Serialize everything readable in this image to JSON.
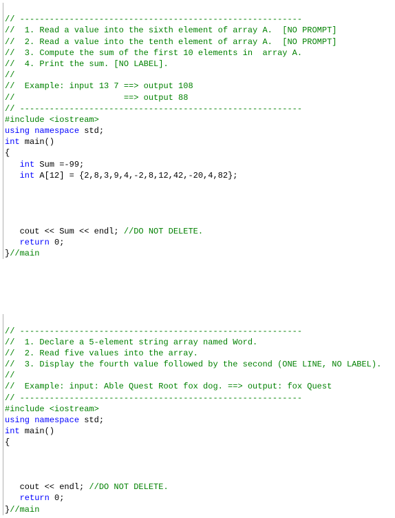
{
  "block1": {
    "c01": "// ---------------------------------------------------------",
    "c02": "//  1. Read a value into the sixth element of array A.  [NO PROMPT]",
    "c03": "//  2. Read a value into the tenth element of array A.  [NO PROMPT]",
    "c04": "//  3. Compute the sum of the first 10 elements in  array A.",
    "c05": "//  4. Print the sum. [NO LABEL].",
    "c06": "//",
    "c07": "//  Example: input 13 7 ==> output 108",
    "c08": "//                      ==> output 88",
    "c09": "// ---------------------------------------------------------",
    "inc": "#include <iostream>",
    "ns_using": "using",
    "ns_namespace": " namespace",
    "ns_std": " std;",
    "kw_int": "int",
    "main_decl": " main()",
    "brace_open": "{",
    "line_sum_int": "   int",
    "line_sum_rest": " Sum =-99;",
    "line_arr_int": "   int",
    "line_arr_rest": " A[12] = {2,8,3,9,4,-2,8,12,42,-20,4,82};",
    "cout_line_pre": "   cout << Sum << endl; ",
    "cout_comment": "//DO NOT DELETE.",
    "return_kw": "   return",
    "return_rest": " 0;",
    "brace_close": "}",
    "brace_comment": "//main"
  },
  "block2": {
    "c01": "// ---------------------------------------------------------",
    "c02": "//  1. Declare a 5-element string array named Word.",
    "c03": "//  2. Read five values into the array.",
    "c04": "//  3. Display the fourth value followed by the second (ONE LINE, NO LABEL).",
    "c05": "//",
    "c06": "//  Example: input: Able Quest Root fox dog. ==> output: fox Quest",
    "c07": "// ---------------------------------------------------------",
    "inc": "#include <iostream>",
    "ns_using": "using",
    "ns_namespace": " namespace",
    "ns_std": " std;",
    "kw_int": "int",
    "main_decl": " main()",
    "brace_open": "{",
    "cout_line_pre": "   cout << endl; ",
    "cout_comment": "//DO NOT DELETE.",
    "return_kw": "   return",
    "return_rest": " 0;",
    "brace_close": "}",
    "brace_comment": "//main"
  }
}
